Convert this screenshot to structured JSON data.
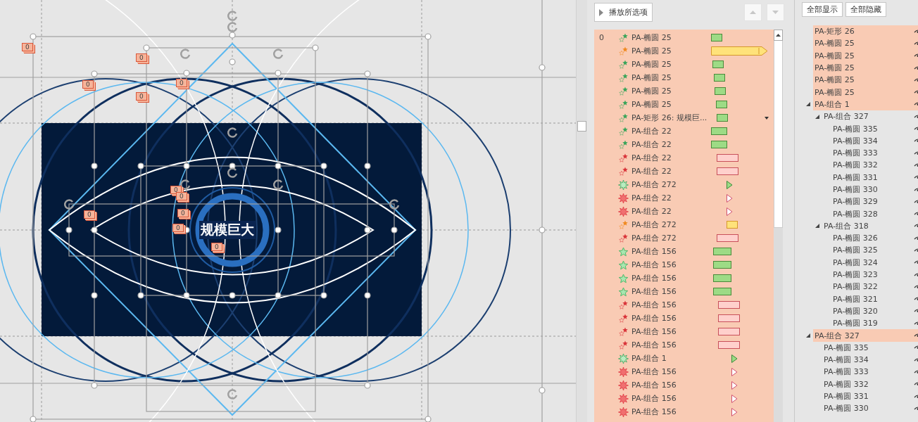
{
  "slide": {
    "title_text": "规模巨大",
    "tags": [
      "0",
      "0",
      "0",
      "0",
      "0",
      "0",
      "0",
      "0",
      "0",
      "0",
      "0"
    ]
  },
  "animation_pane": {
    "play_button": "播放所选项",
    "move_up": {
      "disabled": true
    },
    "move_down": {
      "disabled": true
    },
    "rows": [
      {
        "step": "0",
        "kind": "entrance",
        "name": "PA-椭圆 25",
        "bar": {
          "kind": "block"
        },
        "hovered": false
      },
      {
        "kind": "emphasis",
        "name": "PA-椭圆 25",
        "bar": {
          "kind": "long"
        },
        "hovered": false
      },
      {
        "kind": "entrance",
        "name": "PA-椭圆 25",
        "bar": {
          "kind": "block"
        },
        "hovered": false
      },
      {
        "kind": "entrance",
        "name": "PA-椭圆 25",
        "bar": {
          "kind": "block"
        },
        "hovered": false
      },
      {
        "kind": "entrance",
        "name": "PA-椭圆 25",
        "bar": {
          "kind": "block"
        },
        "hovered": false
      },
      {
        "kind": "entrance",
        "name": "PA-椭圆 25",
        "bar": {
          "kind": "block"
        },
        "hovered": false
      },
      {
        "kind": "entrance",
        "name": "PA-矩形 26: 规模巨...",
        "bar": {
          "kind": "block"
        },
        "hovered": true
      },
      {
        "kind": "entrance",
        "name": "PA-组合 22",
        "bar": {
          "kind": "block"
        },
        "hovered": false
      },
      {
        "kind": "entrance",
        "name": "PA-组合 22",
        "bar": {
          "kind": "block"
        },
        "hovered": false
      },
      {
        "kind": "exit",
        "name": "PA-组合 22",
        "bar": {
          "kind": "block"
        },
        "hovered": false
      },
      {
        "kind": "exit",
        "name": "PA-组合 22",
        "bar": {
          "kind": "block"
        },
        "hovered": false
      },
      {
        "kind": "burst-entrance",
        "name": "PA-组合 272",
        "bar": {
          "kind": "instant"
        },
        "hovered": false
      },
      {
        "kind": "burst-exit",
        "name": "PA-组合 22",
        "bar": {
          "kind": "instant"
        },
        "hovered": false
      },
      {
        "kind": "burst-exit",
        "name": "PA-组合 22",
        "bar": {
          "kind": "instant"
        },
        "hovered": false
      },
      {
        "kind": "emphasis",
        "name": "PA-组合 272",
        "bar": {
          "kind": "block"
        },
        "hovered": false
      },
      {
        "kind": "exit",
        "name": "PA-组合 272",
        "bar": {
          "kind": "block"
        },
        "hovered": false
      },
      {
        "kind": "entrance-outline",
        "name": "PA-组合 156",
        "bar": {
          "kind": "block"
        },
        "hovered": false
      },
      {
        "kind": "entrance-outline",
        "name": "PA-组合 156",
        "bar": {
          "kind": "block"
        },
        "hovered": false
      },
      {
        "kind": "entrance-outline",
        "name": "PA-组合 156",
        "bar": {
          "kind": "block"
        },
        "hovered": false
      },
      {
        "kind": "entrance-outline",
        "name": "PA-组合 156",
        "bar": {
          "kind": "block"
        },
        "hovered": false
      },
      {
        "kind": "exit",
        "name": "PA-组合 156",
        "bar": {
          "kind": "block"
        },
        "hovered": false
      },
      {
        "kind": "exit",
        "name": "PA-组合 156",
        "bar": {
          "kind": "block"
        },
        "hovered": false
      },
      {
        "kind": "exit",
        "name": "PA-组合 156",
        "bar": {
          "kind": "block"
        },
        "hovered": false
      },
      {
        "kind": "exit",
        "name": "PA-组合 156",
        "bar": {
          "kind": "block"
        },
        "hovered": false
      },
      {
        "kind": "burst-entrance",
        "name": "PA-组合 1",
        "bar": {
          "kind": "instant"
        },
        "hovered": false
      },
      {
        "kind": "burst-exit",
        "name": "PA-组合 156",
        "bar": {
          "kind": "instant"
        },
        "hovered": false
      },
      {
        "kind": "burst-exit",
        "name": "PA-组合 156",
        "bar": {
          "kind": "instant"
        },
        "hovered": false
      },
      {
        "kind": "burst-exit",
        "name": "PA-组合 156",
        "bar": {
          "kind": "instant"
        },
        "hovered": false
      },
      {
        "kind": "burst-exit",
        "name": "PA-组合 156",
        "bar": {
          "kind": "instant"
        },
        "hovered": false
      }
    ]
  },
  "selection_pane": {
    "show_all": "全部显示",
    "hide_all": "全部隐藏",
    "items": [
      {
        "name": "PA-矩形 26",
        "selected": true
      },
      {
        "name": "PA-椭圆 25",
        "selected": true
      },
      {
        "name": "PA-椭圆 25",
        "selected": true
      },
      {
        "name": "PA-椭圆 25",
        "selected": true
      },
      {
        "name": "PA-椭圆 25",
        "selected": true
      },
      {
        "name": "PA-椭圆 25",
        "selected": true
      },
      {
        "name": "PA-组合 1",
        "selected": true,
        "expanded": true,
        "children": [
          {
            "name": "PA-组合 327",
            "selected": false,
            "expanded": true,
            "children": [
              {
                "name": "PA-椭圆 335",
                "selected": false
              },
              {
                "name": "PA-椭圆 334",
                "selected": false
              },
              {
                "name": "PA-椭圆 333",
                "selected": false
              },
              {
                "name": "PA-椭圆 332",
                "selected": false
              },
              {
                "name": "PA-椭圆 331",
                "selected": false
              },
              {
                "name": "PA-椭圆 330",
                "selected": false
              },
              {
                "name": "PA-椭圆 329",
                "selected": false
              },
              {
                "name": "PA-椭圆 328",
                "selected": false
              }
            ]
          },
          {
            "name": "PA-组合 318",
            "selected": false,
            "expanded": true,
            "children": [
              {
                "name": "PA-椭圆 326",
                "selected": false
              },
              {
                "name": "PA-椭圆 325",
                "selected": false
              },
              {
                "name": "PA-椭圆 324",
                "selected": false
              },
              {
                "name": "PA-椭圆 323",
                "selected": false
              },
              {
                "name": "PA-椭圆 322",
                "selected": false
              },
              {
                "name": "PA-椭圆 321",
                "selected": false
              },
              {
                "name": "PA-椭圆 320",
                "selected": false
              },
              {
                "name": "PA-椭圆 319",
                "selected": false
              }
            ]
          }
        ]
      },
      {
        "name": "PA-组合 327",
        "selected": true,
        "expanded": true,
        "children": [
          {
            "name": "PA-椭圆 335",
            "selected": false
          },
          {
            "name": "PA-椭圆 334",
            "selected": false
          },
          {
            "name": "PA-椭圆 333",
            "selected": false
          },
          {
            "name": "PA-椭圆 332",
            "selected": false
          },
          {
            "name": "PA-椭圆 331",
            "selected": false
          },
          {
            "name": "PA-椭圆 330",
            "selected": false
          }
        ]
      }
    ]
  }
}
